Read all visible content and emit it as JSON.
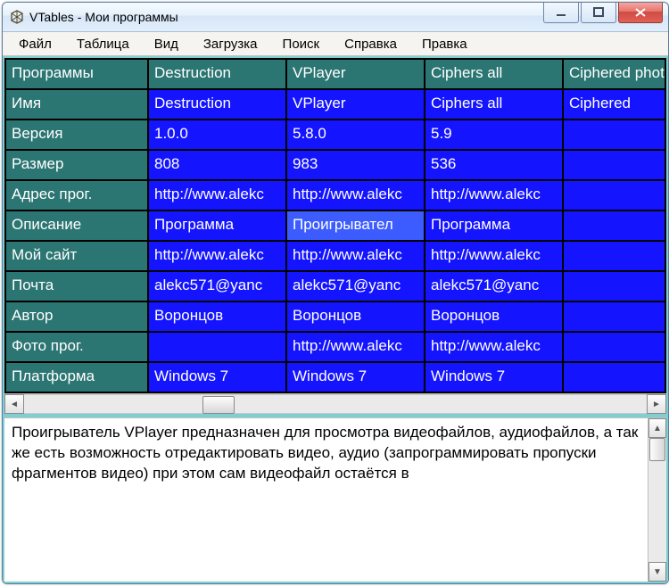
{
  "window": {
    "title": "VTables - Мои программы"
  },
  "menu": {
    "items": [
      "Файл",
      "Таблица",
      "Вид",
      "Загрузка",
      "Поиск",
      "Справка",
      "Правка"
    ]
  },
  "table": {
    "corner": "Программы",
    "columns": [
      "Destruction",
      "VPlayer",
      "Ciphers all",
      "Ciphered photos"
    ],
    "rows": [
      {
        "label": "Имя",
        "cells": [
          "Destruction",
          "VPlayer",
          "Ciphers all",
          "Ciphered"
        ]
      },
      {
        "label": "Версия",
        "cells": [
          "1.0.0",
          "5.8.0",
          "5.9",
          ""
        ]
      },
      {
        "label": "Размер",
        "cells": [
          "808",
          "983",
          "536",
          ""
        ]
      },
      {
        "label": "Адрес прог.",
        "cells": [
          "http://www.alekc",
          "http://www.alekc",
          "http://www.alekc",
          ""
        ]
      },
      {
        "label": "Описание",
        "cells": [
          "Программа",
          "Проигрывател",
          "Программа",
          ""
        ]
      },
      {
        "label": "Мой сайт",
        "cells": [
          "http://www.alekc",
          "http://www.alekc",
          "http://www.alekc",
          ""
        ]
      },
      {
        "label": "Почта",
        "cells": [
          "alekc571@yanc",
          "alekc571@yanc",
          "alekc571@yanc",
          ""
        ]
      },
      {
        "label": "Автор",
        "cells": [
          "Воронцов",
          "Воронцов",
          "Воронцов",
          ""
        ]
      },
      {
        "label": "Фото прог.",
        "cells": [
          "",
          "http://www.alekc",
          "http://www.alekc",
          ""
        ]
      },
      {
        "label": "Платформа",
        "cells": [
          "Windows 7",
          "Windows 7",
          "Windows 7",
          ""
        ]
      }
    ],
    "selected": {
      "row": 4,
      "col": 1
    }
  },
  "description": "Проигрыватель VPlayer предназначен для просмотра видеофайлов, аудиофайлов, а так же есть возможность отредактировать видео, аудио (запрограммировать пропуски фрагментов видео) при этом сам видеофайл остаётся в",
  "colors": {
    "teal": "#2b7572",
    "blue": "#1414ff",
    "accent_border": "#7fcfd2"
  }
}
